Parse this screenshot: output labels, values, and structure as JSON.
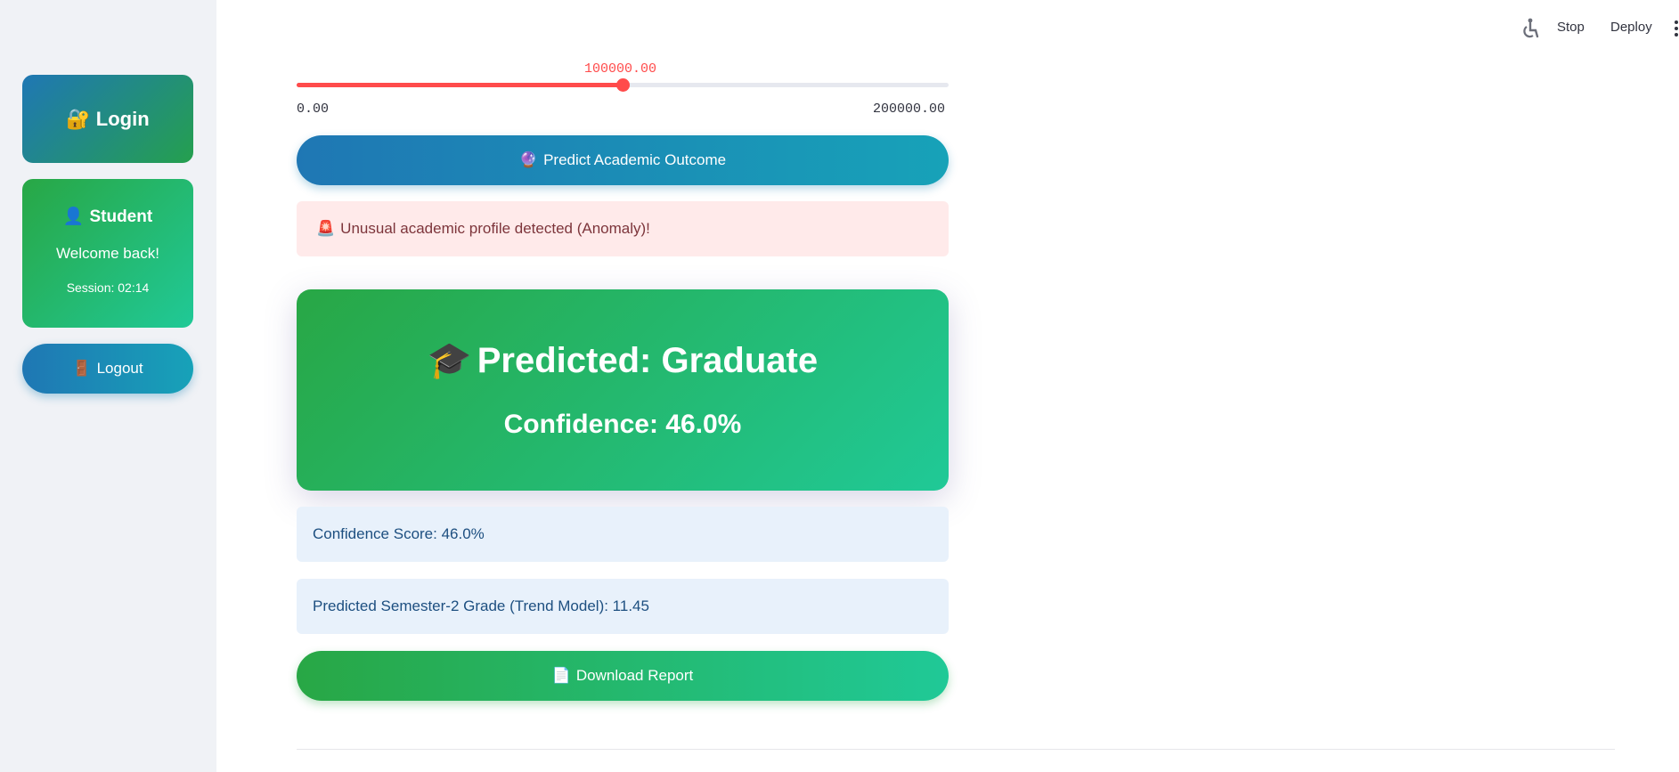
{
  "sidebar": {
    "login": {
      "icon": "🔐",
      "label": "Login"
    },
    "student": {
      "icon": "👤",
      "title": "Student",
      "welcome": "Welcome back!",
      "session": "Session: 02:14"
    },
    "logout": {
      "icon": "🚪",
      "label": "Logout"
    }
  },
  "topbar": {
    "stop_label": "Stop",
    "deploy_label": "Deploy"
  },
  "slider": {
    "value": "100000.00",
    "min": "0.00",
    "max": "200000.00",
    "fraction": 0.5
  },
  "predict_button": {
    "icon": "🔮",
    "label": "Predict Academic Outcome"
  },
  "anomaly_alert": {
    "icon": "🚨",
    "text": "Unusual academic profile detected (Anomaly)!"
  },
  "result": {
    "icon": "🎓",
    "headline": "Predicted: Graduate",
    "confidence": "Confidence: 46.0%"
  },
  "info": {
    "confidence_score": "Confidence Score: 46.0%",
    "semester_grade": "Predicted Semester-2 Grade (Trend Model): 11.45"
  },
  "download_button": {
    "icon": "📄",
    "label": "Download Report"
  },
  "colors": {
    "accent_red": "#ff4b4b",
    "blue": "#1f77b4",
    "green": "#28a745",
    "teal": "#20c997"
  }
}
